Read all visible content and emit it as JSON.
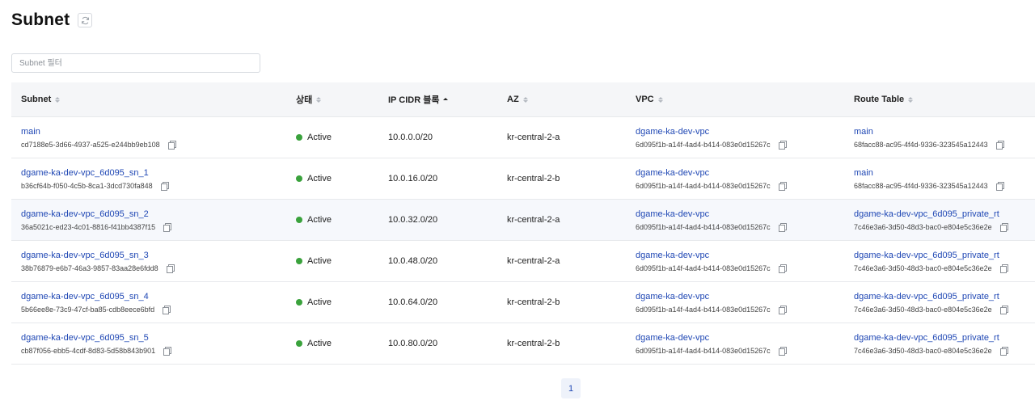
{
  "page": {
    "title": "Subnet"
  },
  "filter": {
    "placeholder": "Subnet 필터"
  },
  "table": {
    "columns": [
      "Subnet",
      "상태",
      "IP CIDR 블록",
      "AZ",
      "VPC",
      "Route Table"
    ],
    "sorted_column": "IP CIDR 블록",
    "rows": [
      {
        "name": "main",
        "id": "cd7188e5-3d66-4937-a525-e244bb9eb108",
        "status": "Active",
        "cidr": "10.0.0.0/20",
        "az": "kr-central-2-a",
        "vpc_name": "dgame-ka-dev-vpc",
        "vpc_id": "6d095f1b-a14f-4ad4-b414-083e0d15267c",
        "rt_name": "main",
        "rt_id": "68facc88-ac95-4f4d-9336-323545a12443"
      },
      {
        "name": "dgame-ka-dev-vpc_6d095_sn_1",
        "id": "b36cf64b-f050-4c5b-8ca1-3dcd730fa848",
        "status": "Active",
        "cidr": "10.0.16.0/20",
        "az": "kr-central-2-b",
        "vpc_name": "dgame-ka-dev-vpc",
        "vpc_id": "6d095f1b-a14f-4ad4-b414-083e0d15267c",
        "rt_name": "main",
        "rt_id": "68facc88-ac95-4f4d-9336-323545a12443"
      },
      {
        "name": "dgame-ka-dev-vpc_6d095_sn_2",
        "id": "36a5021c-ed23-4c01-8816-f41bb4387f15",
        "status": "Active",
        "cidr": "10.0.32.0/20",
        "az": "kr-central-2-a",
        "vpc_name": "dgame-ka-dev-vpc",
        "vpc_id": "6d095f1b-a14f-4ad4-b414-083e0d15267c",
        "rt_name": "dgame-ka-dev-vpc_6d095_private_rt",
        "rt_id": "7c46e3a6-3d50-48d3-bac0-e804e5c36e2e"
      },
      {
        "name": "dgame-ka-dev-vpc_6d095_sn_3",
        "id": "38b76879-e6b7-46a3-9857-83aa28e6fdd8",
        "status": "Active",
        "cidr": "10.0.48.0/20",
        "az": "kr-central-2-a",
        "vpc_name": "dgame-ka-dev-vpc",
        "vpc_id": "6d095f1b-a14f-4ad4-b414-083e0d15267c",
        "rt_name": "dgame-ka-dev-vpc_6d095_private_rt",
        "rt_id": "7c46e3a6-3d50-48d3-bac0-e804e5c36e2e"
      },
      {
        "name": "dgame-ka-dev-vpc_6d095_sn_4",
        "id": "5b66ee8e-73c9-47cf-ba85-cdb8eece6bfd",
        "status": "Active",
        "cidr": "10.0.64.0/20",
        "az": "kr-central-2-b",
        "vpc_name": "dgame-ka-dev-vpc",
        "vpc_id": "6d095f1b-a14f-4ad4-b414-083e0d15267c",
        "rt_name": "dgame-ka-dev-vpc_6d095_private_rt",
        "rt_id": "7c46e3a6-3d50-48d3-bac0-e804e5c36e2e"
      },
      {
        "name": "dgame-ka-dev-vpc_6d095_sn_5",
        "id": "cb87f056-ebb5-4cdf-8d83-5d58b843b901",
        "status": "Active",
        "cidr": "10.0.80.0/20",
        "az": "kr-central-2-b",
        "vpc_name": "dgame-ka-dev-vpc",
        "vpc_id": "6d095f1b-a14f-4ad4-b414-083e0d15267c",
        "rt_name": "dgame-ka-dev-vpc_6d095_private_rt",
        "rt_id": "7c46e3a6-3d50-48d3-bac0-e804e5c36e2e"
      }
    ]
  },
  "pagination": {
    "current_page": "1"
  },
  "colors": {
    "link": "#1f47b4",
    "status_active": "#3aa23c",
    "header_bg": "#f5f6f8",
    "highlight_row": "#f6f8fc"
  },
  "icons": {
    "refresh": "refresh-icon",
    "copy": "copy-icon",
    "sort": "sort-icon"
  }
}
